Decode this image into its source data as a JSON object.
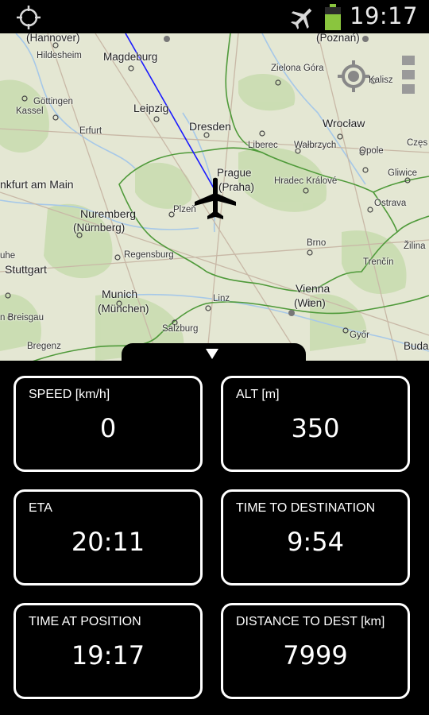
{
  "status_bar": {
    "time": "19:17",
    "icons": [
      "gps-icon",
      "airplane-mode-icon",
      "battery-icon"
    ],
    "battery_color": "#8ac53e"
  },
  "map": {
    "cities": [
      {
        "id": "hannover",
        "name": "(Hannover)"
      },
      {
        "id": "hildesheim",
        "name": "Hildesheim"
      },
      {
        "id": "magdeburg",
        "name": "Magdeburg"
      },
      {
        "id": "poznan",
        "name": "(Poznań)"
      },
      {
        "id": "gottingen",
        "name": "Göttingen"
      },
      {
        "id": "kassel",
        "name": "Kassel"
      },
      {
        "id": "leipzig",
        "name": "Leipzig"
      },
      {
        "id": "zielona",
        "name": "Zielona Góra"
      },
      {
        "id": "kalisz",
        "name": "Kalisz"
      },
      {
        "id": "erfurt",
        "name": "Erfurt"
      },
      {
        "id": "dresden",
        "name": "Dresden"
      },
      {
        "id": "wroclaw",
        "name": "Wrocław"
      },
      {
        "id": "liberec",
        "name": "Liberec"
      },
      {
        "id": "walbrzych",
        "name": "Wałbrzych"
      },
      {
        "id": "opole",
        "name": "Opole"
      },
      {
        "id": "czes",
        "name": "Częs"
      },
      {
        "id": "frankfurt",
        "name": "nkfurt am Main"
      },
      {
        "id": "prague",
        "name": "Prague"
      },
      {
        "id": "praha",
        "name": "(Praha)"
      },
      {
        "id": "hradec",
        "name": "Hradec Králové"
      },
      {
        "id": "gliwice",
        "name": "Gliwice"
      },
      {
        "id": "nuremberg",
        "name": "Nuremberg"
      },
      {
        "id": "nurnberg",
        "name": "(Nürnberg)"
      },
      {
        "id": "plzen",
        "name": "Plzeň"
      },
      {
        "id": "ostrava",
        "name": "Ostrava"
      },
      {
        "id": "uhe",
        "name": "uhe"
      },
      {
        "id": "stuttgart",
        "name": "Stuttgart"
      },
      {
        "id": "regensburg",
        "name": "Regensburg"
      },
      {
        "id": "brno",
        "name": "Brno"
      },
      {
        "id": "trencin",
        "name": "Trenčín"
      },
      {
        "id": "zilina",
        "name": "Žilina"
      },
      {
        "id": "munich",
        "name": "Munich"
      },
      {
        "id": "munchen",
        "name": "(München)"
      },
      {
        "id": "linz",
        "name": "Linz"
      },
      {
        "id": "vienna",
        "name": "Vienna"
      },
      {
        "id": "wien",
        "name": "(Wien)"
      },
      {
        "id": "breisgau",
        "name": "n Breisgau"
      },
      {
        "id": "salzburg",
        "name": "Salzburg"
      },
      {
        "id": "gyor",
        "name": "Győr"
      },
      {
        "id": "budapest",
        "name": "Buda"
      },
      {
        "id": "bregenz",
        "name": "Bregenz"
      }
    ],
    "route_color": "#1a1aff"
  },
  "tiles": [
    {
      "id": "speed",
      "label": "SPEED [km/h]",
      "value": "0"
    },
    {
      "id": "alt",
      "label": "ALT [m]",
      "value": "350"
    },
    {
      "id": "eta",
      "label": "ETA",
      "value": "20:11"
    },
    {
      "id": "ttd",
      "label": "TIME TO DESTINATION",
      "value": "9:54"
    },
    {
      "id": "tap",
      "label": "TIME AT POSITION",
      "value": "19:17"
    },
    {
      "id": "dtd",
      "label": "DISTANCE TO DEST [km]",
      "value": "7999"
    }
  ]
}
